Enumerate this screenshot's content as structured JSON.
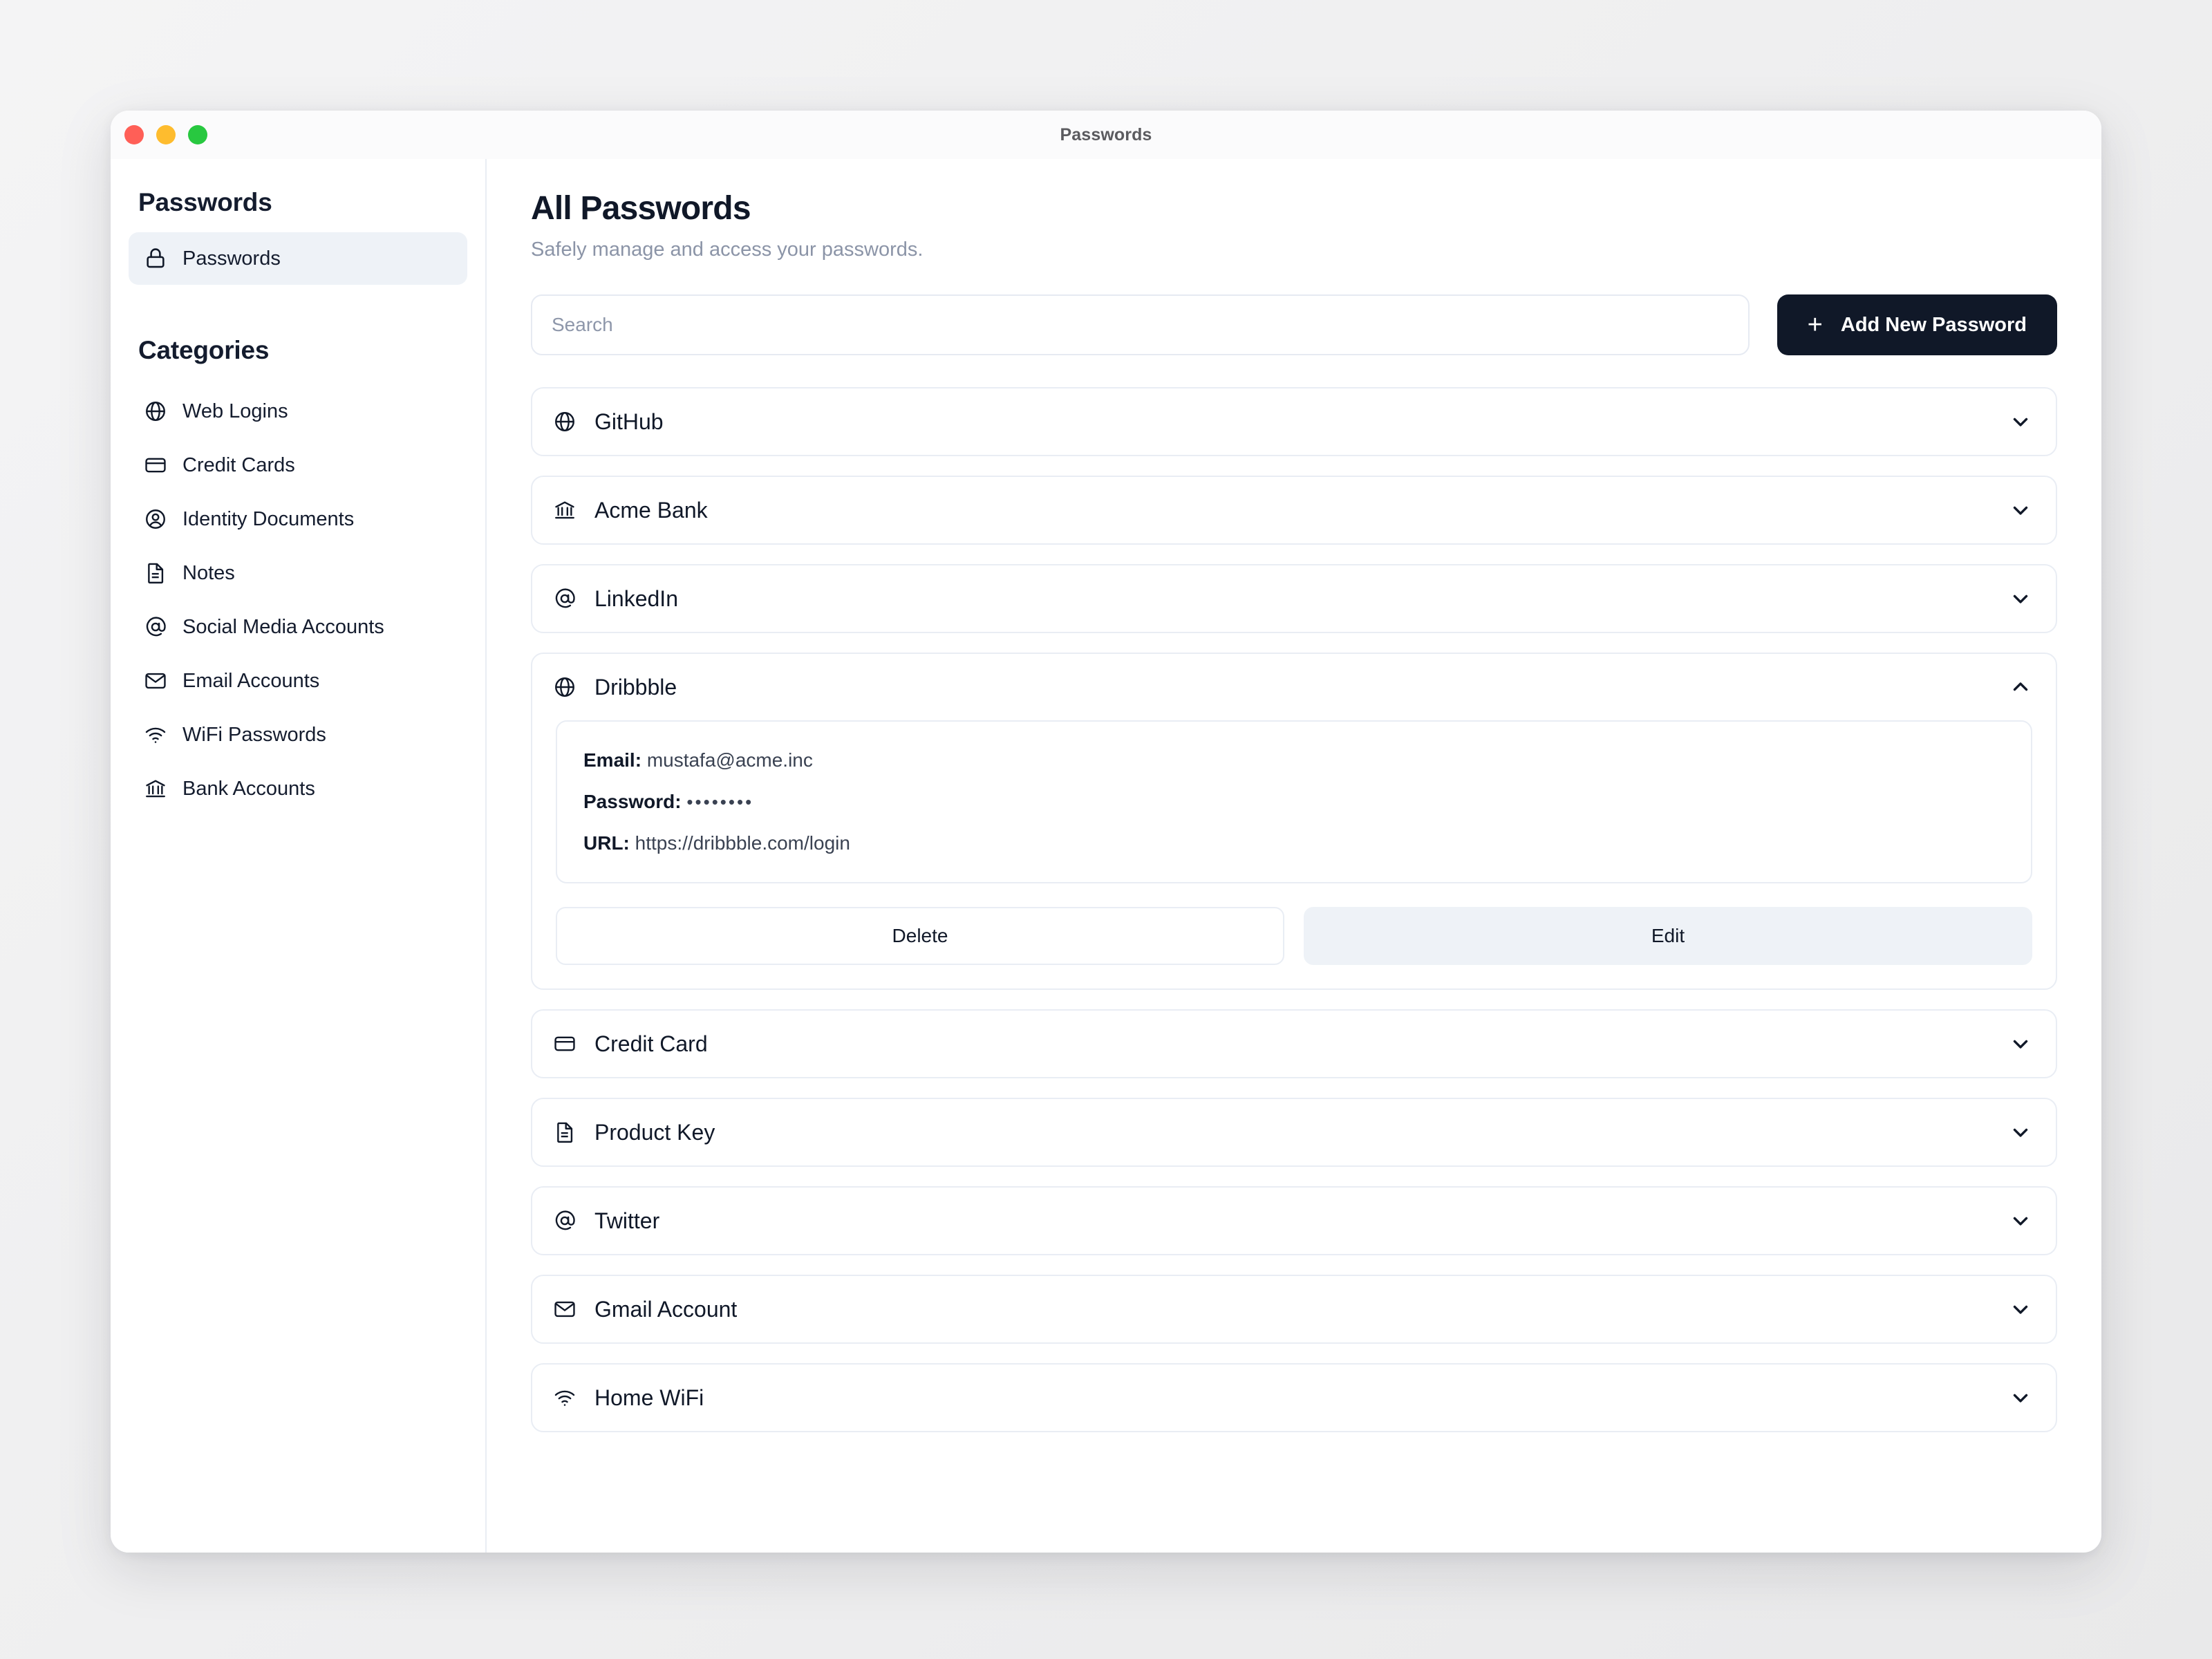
{
  "window": {
    "title": "Passwords",
    "traffic_lights": [
      {
        "name": "close",
        "color": "#ff5f57"
      },
      {
        "name": "minimize",
        "color": "#febc2e"
      },
      {
        "name": "maximize",
        "color": "#28c840"
      }
    ]
  },
  "sidebar": {
    "heading": "Passwords",
    "items": [
      {
        "label": "Passwords",
        "icon": "lock-icon",
        "active": true
      }
    ],
    "categories_heading": "Categories",
    "categories": [
      {
        "label": "Web Logins",
        "icon": "globe-icon"
      },
      {
        "label": "Credit Cards",
        "icon": "credit-card-icon"
      },
      {
        "label": "Identity Documents",
        "icon": "user-circle-icon"
      },
      {
        "label": "Notes",
        "icon": "document-icon"
      },
      {
        "label": "Social Media Accounts",
        "icon": "at-sign-icon"
      },
      {
        "label": "Email Accounts",
        "icon": "envelope-icon"
      },
      {
        "label": "WiFi Passwords",
        "icon": "wifi-icon"
      },
      {
        "label": "Bank Accounts",
        "icon": "bank-icon"
      }
    ]
  },
  "main": {
    "title": "All Passwords",
    "subtitle": "Safely manage and access your passwords.",
    "search": {
      "value": "",
      "placeholder": "Search"
    },
    "add_button": {
      "label": "Add New Password",
      "icon": "plus-icon"
    },
    "entries": [
      {
        "name": "GitHub",
        "icon": "globe-icon",
        "expanded": false,
        "chevron": "chevron-down-icon"
      },
      {
        "name": "Acme Bank",
        "icon": "bank-icon",
        "expanded": false,
        "chevron": "chevron-down-icon"
      },
      {
        "name": "LinkedIn",
        "icon": "at-sign-icon",
        "expanded": false,
        "chevron": "chevron-down-icon"
      },
      {
        "name": "Dribbble",
        "icon": "globe-icon",
        "expanded": true,
        "chevron": "chevron-up-icon",
        "details": {
          "email_label": "Email:",
          "email_value": "mustafa@acme.inc",
          "password_label": "Password:",
          "password_value": "••••••••",
          "url_label": "URL:",
          "url_value": "https://dribbble.com/login"
        },
        "actions": {
          "delete_label": "Delete",
          "edit_label": "Edit"
        }
      },
      {
        "name": "Credit Card",
        "icon": "credit-card-icon",
        "expanded": false,
        "chevron": "chevron-down-icon"
      },
      {
        "name": "Product Key",
        "icon": "document-icon",
        "expanded": false,
        "chevron": "chevron-down-icon"
      },
      {
        "name": "Twitter",
        "icon": "at-sign-icon",
        "expanded": false,
        "chevron": "chevron-down-icon"
      },
      {
        "name": "Gmail Account",
        "icon": "envelope-icon",
        "expanded": false,
        "chevron": "chevron-down-icon"
      },
      {
        "name": "Home WiFi",
        "icon": "wifi-icon",
        "expanded": false,
        "chevron": "chevron-down-icon"
      }
    ]
  },
  "colors": {
    "accent_dark": "#101828",
    "surface": "#ffffff",
    "border": "#e9edf4",
    "muted_text": "#8b94a7",
    "active_bg": "#eef2f7",
    "page_bg": "#f2f2f3"
  }
}
